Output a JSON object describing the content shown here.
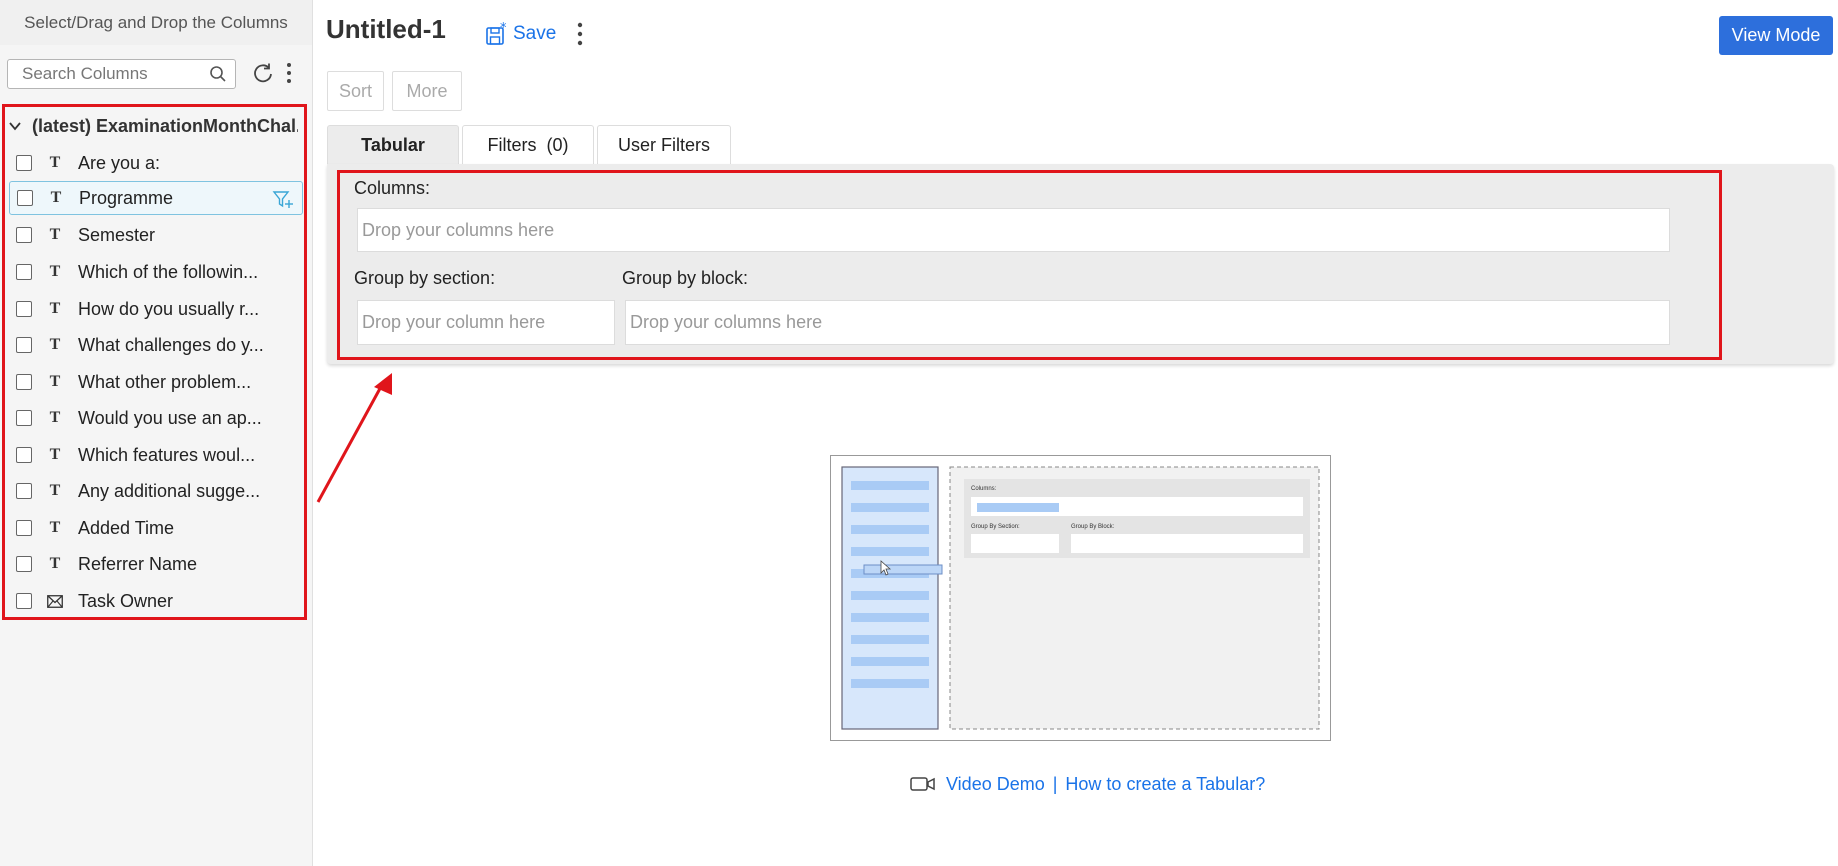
{
  "sidebar": {
    "title": "Select/Drag and Drop the Columns",
    "search_placeholder": "Search Columns",
    "table_name": "(latest) ExaminationMonthChal...",
    "columns": [
      {
        "label": "Are you a:",
        "type": "text"
      },
      {
        "label": "Programme",
        "type": "text"
      },
      {
        "label": "Semester",
        "type": "text"
      },
      {
        "label": "Which of the followin...",
        "type": "text"
      },
      {
        "label": "How do you usually r...",
        "type": "text"
      },
      {
        "label": "What challenges do y...",
        "type": "text"
      },
      {
        "label": "What other problem...",
        "type": "text"
      },
      {
        "label": "Would you use an ap...",
        "type": "text"
      },
      {
        "label": "Which features woul...",
        "type": "text"
      },
      {
        "label": "Any additional sugge...",
        "type": "text"
      },
      {
        "label": "Added Time",
        "type": "text"
      },
      {
        "label": "Referrer Name",
        "type": "text"
      },
      {
        "label": "Task Owner",
        "type": "email"
      }
    ]
  },
  "header": {
    "title": "Untitled-1",
    "save_label": "Save",
    "view_mode_label": "View Mode"
  },
  "toolbar": {
    "sort_label": "Sort",
    "more_label": "More"
  },
  "tabs": [
    {
      "label": "Tabular"
    },
    {
      "label": "Filters  (0)"
    },
    {
      "label": "User Filters"
    }
  ],
  "panel": {
    "columns_label": "Columns:",
    "columns_placeholder": "Drop your columns here",
    "group_section_label": "Group by section:",
    "group_section_placeholder": "Drop your column here",
    "group_block_label": "Group by block:",
    "group_block_placeholder": "Drop your columns here"
  },
  "illustration": {
    "columns_label": "Columns:",
    "group_section_label": "Group By Section:",
    "group_block_label": "Group By Block:"
  },
  "links": {
    "video_demo": "Video Demo",
    "separator": "|",
    "how_to": "How to create a Tabular?"
  },
  "colors": {
    "accent": "#1a73e8",
    "primary_button": "#2d6fdc",
    "highlight_border": "#e0151b"
  }
}
